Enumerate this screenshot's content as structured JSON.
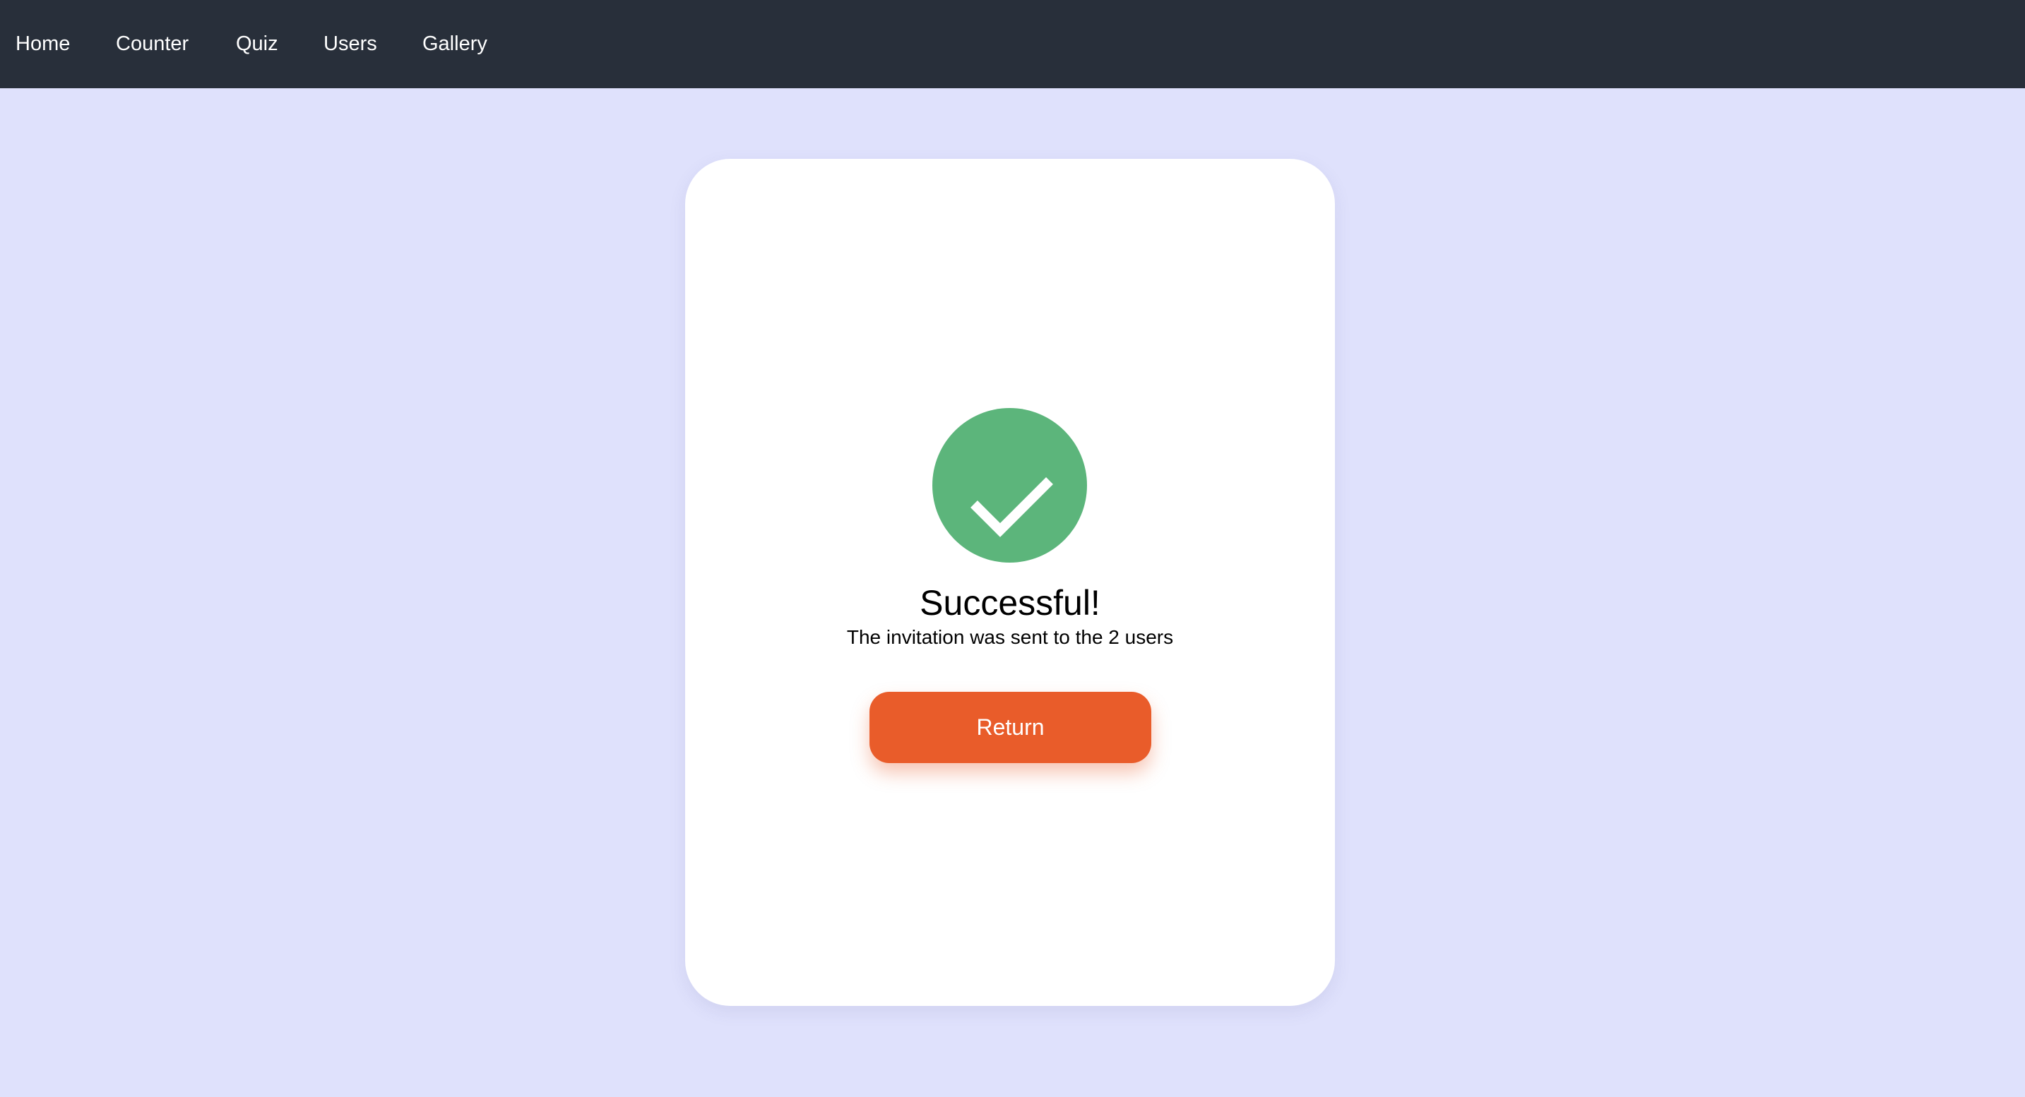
{
  "nav": {
    "items": [
      {
        "label": "Home"
      },
      {
        "label": "Counter"
      },
      {
        "label": "Quiz"
      },
      {
        "label": "Users"
      },
      {
        "label": "Gallery"
      }
    ]
  },
  "card": {
    "icon": "check-circle-icon",
    "title": "Successful!",
    "message": "The invitation was sent to the 2 users",
    "button_label": "Return"
  },
  "colors": {
    "navbar_bg": "#282f3a",
    "page_bg": "#dfe1fc",
    "success_green": "#5cb57b",
    "accent_orange": "#e95c2a"
  }
}
